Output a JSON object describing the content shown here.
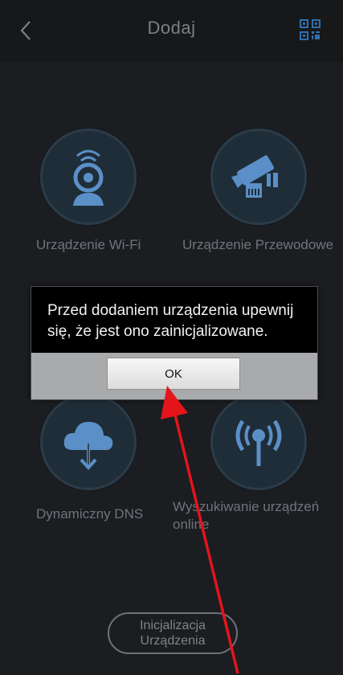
{
  "header": {
    "title": "Dodaj",
    "back_icon": "chevron-left-icon",
    "qr_icon": "qr-scan-icon"
  },
  "tiles": [
    {
      "label": "Urządzenie Wi-Fi",
      "icon": "wifi-camera-icon"
    },
    {
      "label": "Urządzenie Przewodowe",
      "icon": "wired-camera-icon"
    },
    {
      "label": "Dynamiczny DNS",
      "icon": "cloud-download-icon"
    },
    {
      "label": "Wyszukiwanie urządzeń online",
      "icon": "signal-search-icon"
    }
  ],
  "dialog": {
    "message": "Przed dodaniem urządzenia upewnij się, że jest ono zainicjalizowane.",
    "ok_label": "OK"
  },
  "init_button": {
    "line1": "Inicjalizacja",
    "line2": "Urządzenia"
  },
  "colors": {
    "background": "#1b1d20",
    "icon_blue": "#5b8fc7",
    "arrow_red": "#e3151b"
  }
}
